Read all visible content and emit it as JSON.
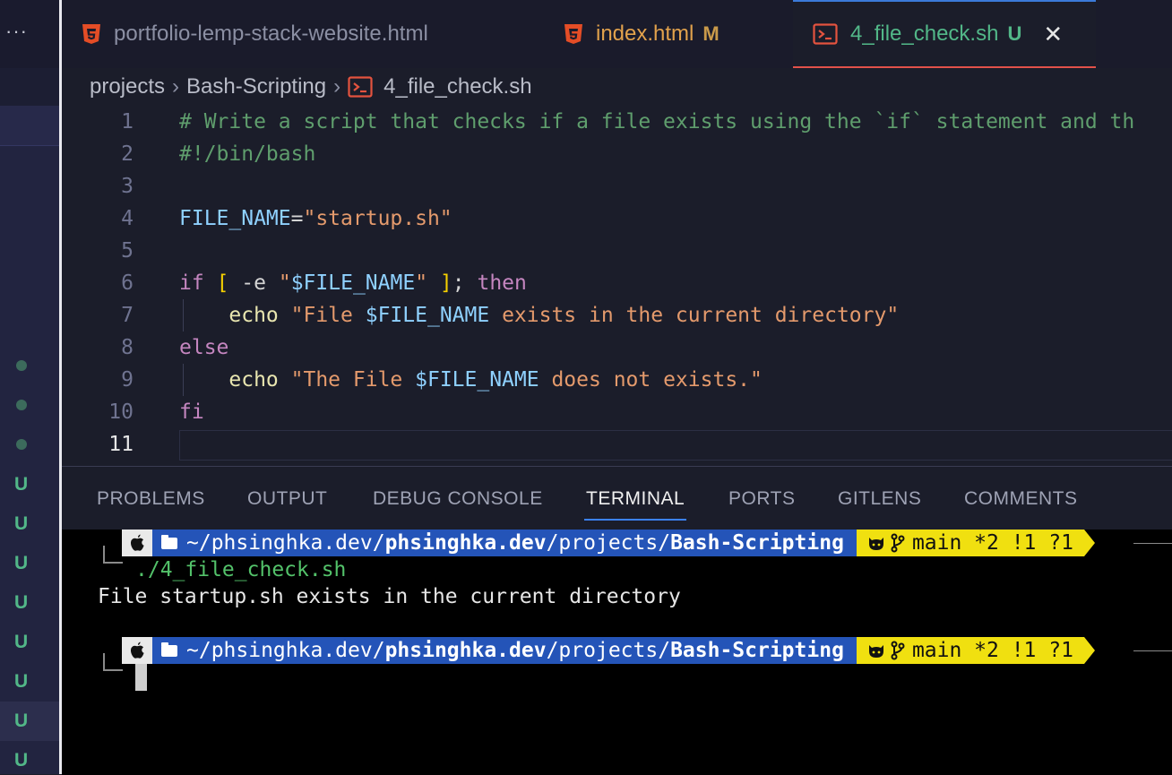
{
  "sidebar": {
    "more_label": "···",
    "badges": [
      "U",
      "U",
      "U",
      "U",
      "U",
      "U",
      "U",
      "U"
    ]
  },
  "tabs": [
    {
      "label": "portfolio-lemp-stack-website.html",
      "badge": "",
      "icon": "html5-icon"
    },
    {
      "label": "index.html",
      "badge": "M",
      "icon": "html5-icon"
    },
    {
      "label": "4_file_check.sh",
      "badge": "U",
      "icon": "terminal-icon",
      "active": true
    }
  ],
  "close_glyph": "✕",
  "breadcrumb": {
    "items": [
      "projects",
      "Bash-Scripting"
    ],
    "file": "4_file_check.sh",
    "separator": "›"
  },
  "code": {
    "line_numbers": [
      "1",
      "2",
      "3",
      "4",
      "5",
      "6",
      "7",
      "8",
      "9",
      "10",
      "11"
    ],
    "lines": [
      "# Write a script that checks if a file exists using the `if` statement and th",
      "#!/bin/bash",
      "",
      "FILE_NAME=\"startup.sh\"",
      "",
      "if [ -e \"$FILE_NAME\" ]; then",
      "    echo \"File $FILE_NAME exists in the current directory\"",
      "else",
      "    echo \"The File $FILE_NAME does not exists.\"",
      "fi",
      ""
    ]
  },
  "panel": {
    "tabs": [
      "PROBLEMS",
      "OUTPUT",
      "DEBUG CONSOLE",
      "TERMINAL",
      "PORTS",
      "GITLENS",
      "COMMENTS"
    ],
    "active_tab": "TERMINAL"
  },
  "terminal": {
    "prompt": {
      "path_prefix": "~/phsinghka.dev/",
      "path_bold1": "phsinghka.dev",
      "path_mid": "/projects/",
      "path_bold2": "Bash-Scripting",
      "git_branch": "main *2 !1 ?1"
    },
    "command": "./4_file_check.sh",
    "output": "File startup.sh exists in the current directory"
  },
  "colors": {
    "accent_blue": "#3b82f6",
    "untracked_green": "#52b788",
    "modified_gold": "#c99a4a",
    "prompt_path_bg": "#2454b8",
    "prompt_git_bg": "#f0e010"
  }
}
